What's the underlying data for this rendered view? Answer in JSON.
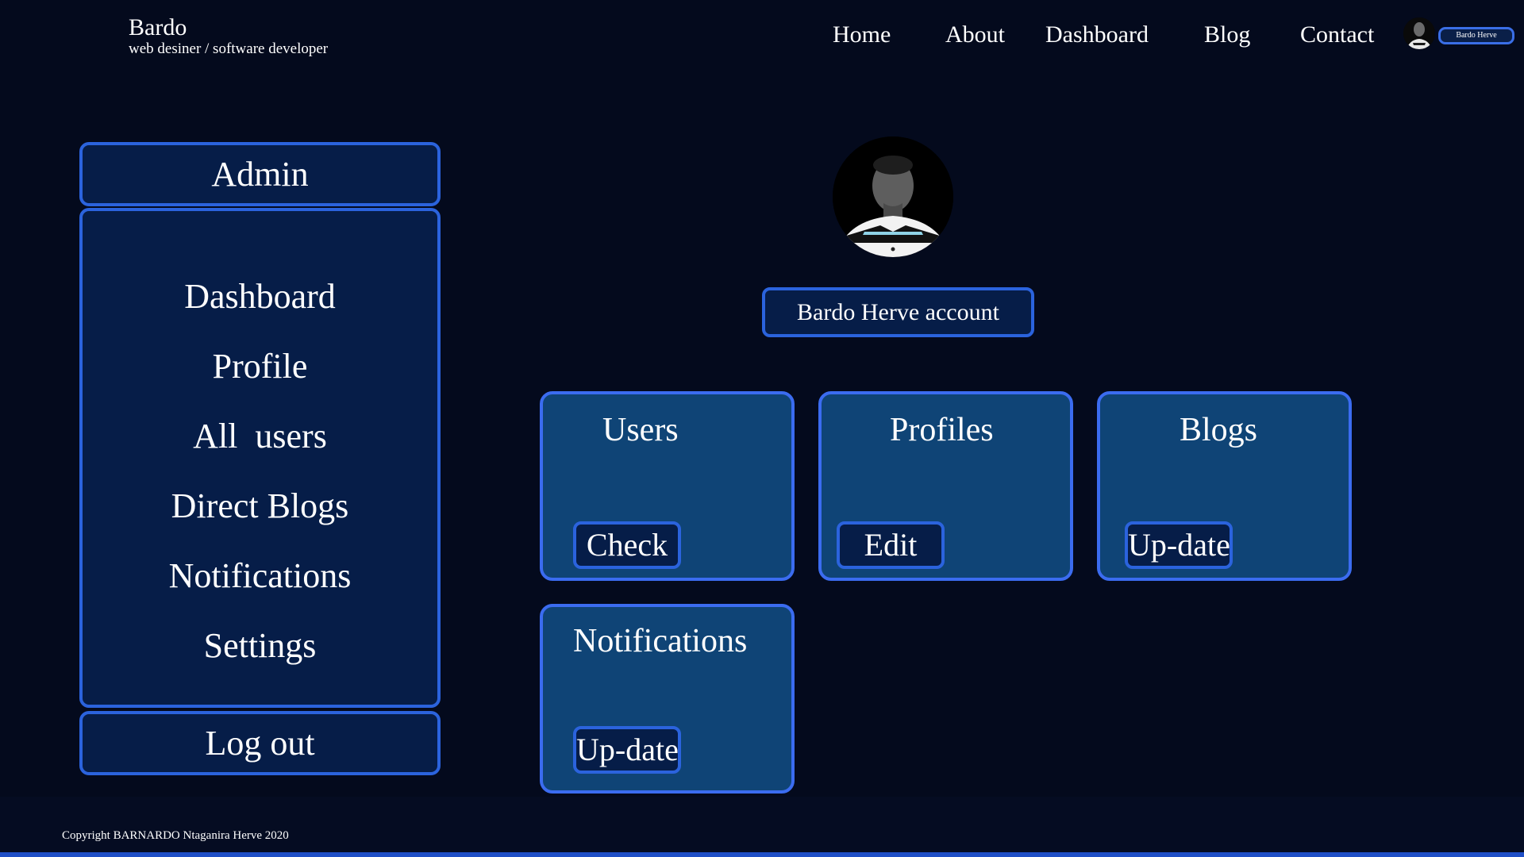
{
  "brand": {
    "name": "Bardo",
    "tagline": "web desiner / software developer"
  },
  "nav": {
    "links": [
      "Home",
      "About",
      "Dashboard",
      "Blog",
      "Contact"
    ],
    "user_name": "Bardo Herve"
  },
  "sidebar": {
    "header": "Admin",
    "items": [
      "Dashboard",
      "Profile",
      "All  users",
      "Direct Blogs",
      "Notifications",
      "Settings"
    ],
    "logout": "Log out"
  },
  "profile": {
    "account_label": "Bardo Herve account"
  },
  "cards": [
    {
      "title": "Users",
      "button": "Check"
    },
    {
      "title": "Profiles",
      "button": "Edit"
    },
    {
      "title": "Blogs",
      "button": "Up-date"
    },
    {
      "title": "Notifications",
      "button": "Up-date"
    }
  ],
  "footer": {
    "copyright": "Copyright BARNARDO Ntaganira Herve 2020"
  },
  "colors": {
    "background": "#040a1d",
    "panel": "#061d48",
    "card": "#0f4476",
    "accent_border": "#2b63dd"
  }
}
